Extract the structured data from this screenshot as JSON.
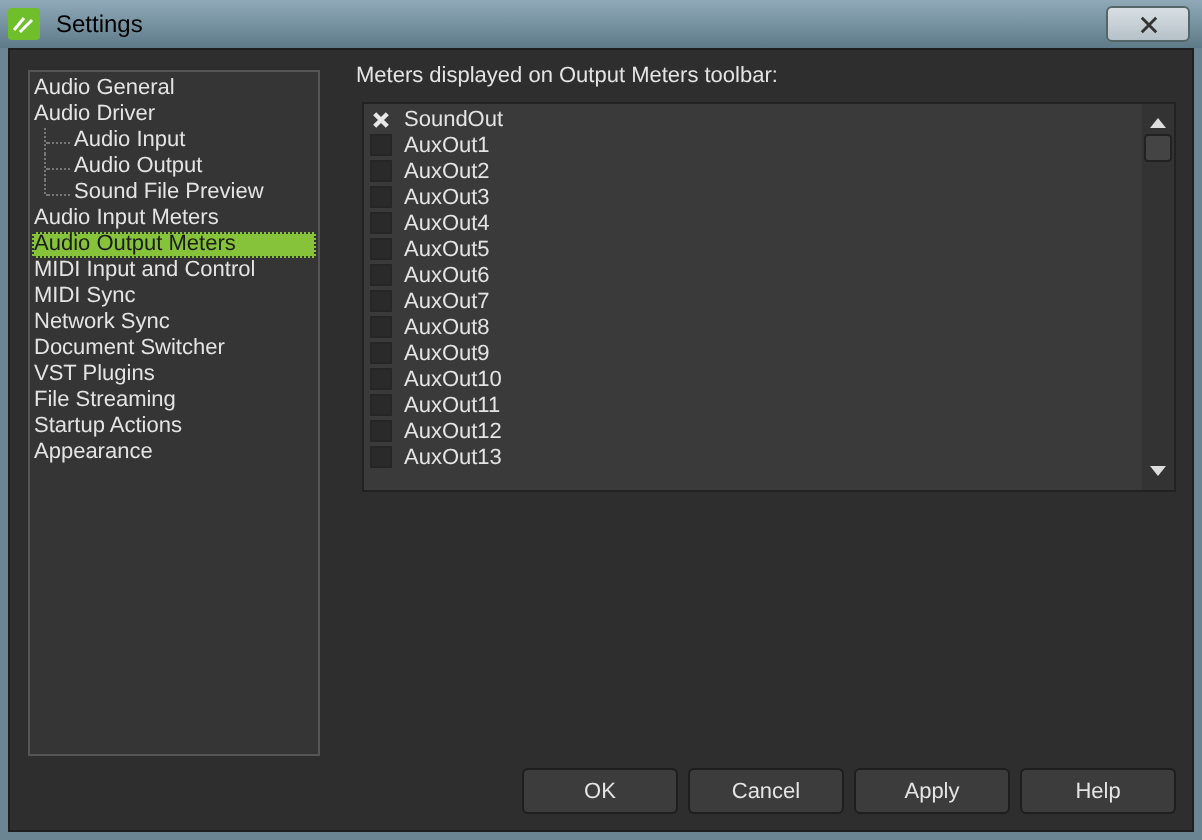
{
  "window": {
    "title": "Settings"
  },
  "sidebar": {
    "items": [
      {
        "label": "Audio General",
        "selected": false
      },
      {
        "label": "Audio Driver",
        "selected": false,
        "children": [
          {
            "label": "Audio Input",
            "selected": false
          },
          {
            "label": "Audio Output",
            "selected": false
          },
          {
            "label": "Sound File Preview",
            "selected": false
          }
        ]
      },
      {
        "label": "Audio Input Meters",
        "selected": false
      },
      {
        "label": "Audio Output Meters",
        "selected": true
      },
      {
        "label": "MIDI Input and Control",
        "selected": false
      },
      {
        "label": "MIDI Sync",
        "selected": false
      },
      {
        "label": "Network Sync",
        "selected": false
      },
      {
        "label": "Document Switcher",
        "selected": false
      },
      {
        "label": "VST Plugins",
        "selected": false
      },
      {
        "label": "File Streaming",
        "selected": false
      },
      {
        "label": "Startup Actions",
        "selected": false
      },
      {
        "label": "Appearance",
        "selected": false
      }
    ]
  },
  "meters": {
    "label": "Meters displayed on Output Meters toolbar:",
    "items": [
      {
        "name": "SoundOut",
        "checked": true
      },
      {
        "name": "AuxOut1",
        "checked": false
      },
      {
        "name": "AuxOut2",
        "checked": false
      },
      {
        "name": "AuxOut3",
        "checked": false
      },
      {
        "name": "AuxOut4",
        "checked": false
      },
      {
        "name": "AuxOut5",
        "checked": false
      },
      {
        "name": "AuxOut6",
        "checked": false
      },
      {
        "name": "AuxOut7",
        "checked": false
      },
      {
        "name": "AuxOut8",
        "checked": false
      },
      {
        "name": "AuxOut9",
        "checked": false
      },
      {
        "name": "AuxOut10",
        "checked": false
      },
      {
        "name": "AuxOut11",
        "checked": false
      },
      {
        "name": "AuxOut12",
        "checked": false
      },
      {
        "name": "AuxOut13",
        "checked": false
      }
    ]
  },
  "buttons": [
    "OK",
    "Cancel",
    "Apply",
    "Help"
  ]
}
